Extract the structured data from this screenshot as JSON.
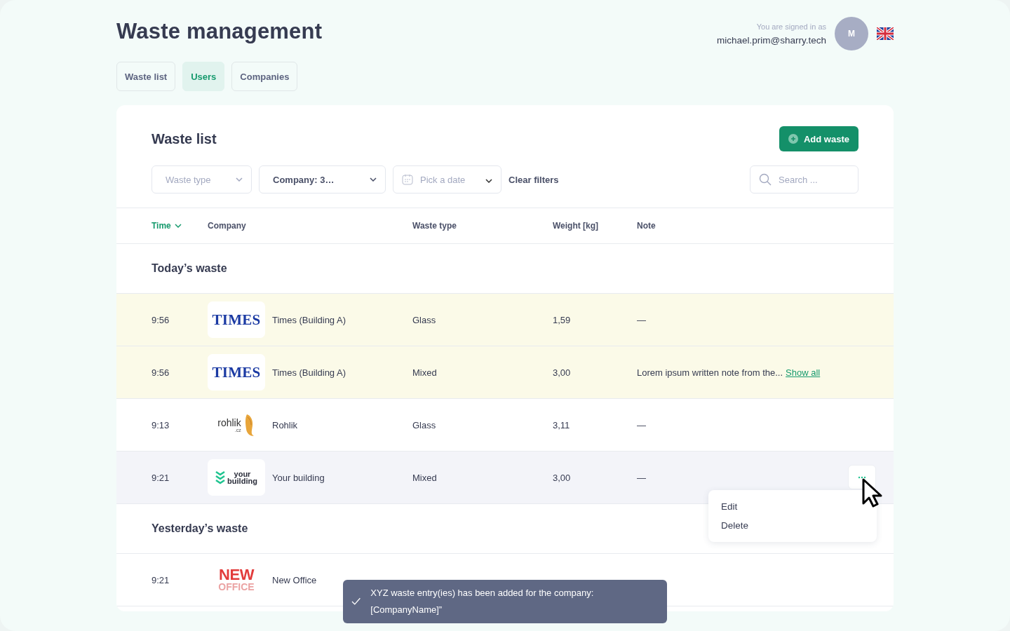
{
  "header": {
    "title": "Waste management",
    "signed_in_label": "You are signed in as",
    "email": "michael.prim@sharry.tech",
    "avatar_initial": "M"
  },
  "tabs": [
    {
      "label": "Waste list",
      "selected": false
    },
    {
      "label": "Users",
      "selected": true
    },
    {
      "label": "Companies",
      "selected": false
    }
  ],
  "panel": {
    "title": "Waste list",
    "add_button": "Add waste",
    "filters": [
      {
        "kind": "select",
        "placeholder": "Waste type"
      },
      {
        "kind": "select",
        "value": "Company: 3…"
      },
      {
        "kind": "date",
        "placeholder": "Pick a date"
      }
    ],
    "clear_filters": "Clear filters",
    "search": {
      "placeholder": "Search ..."
    }
  },
  "table": {
    "columns": [
      {
        "label": "Time",
        "sorted": true
      },
      {
        "label": "Company",
        "sorted": false
      },
      {
        "label": "Waste type",
        "sorted": false
      },
      {
        "label": "Weight [kg]",
        "sorted": false
      },
      {
        "label": "Note",
        "sorted": false
      }
    ],
    "groups": [
      {
        "title": "Today’s waste",
        "rows": [
          {
            "time": "9:56",
            "logo": {
              "kind": "times",
              "lines": [
                "TIMES"
              ]
            },
            "company": "Times (Building A)",
            "waste_type": "Glass",
            "weight": "1,59",
            "note": "—",
            "highlighted": true,
            "hovered": false
          },
          {
            "time": "9:56",
            "logo": {
              "kind": "times",
              "lines": [
                "TIMES"
              ]
            },
            "company": "Times (Building A)",
            "waste_type": "Mixed",
            "weight": "3,00",
            "note": "Lorem ipsum written note from the...",
            "note_link": "Show all",
            "highlighted": true,
            "hovered": false
          },
          {
            "time": "9:13",
            "logo": {
              "kind": "rohlik",
              "lines": [
                "rohlik",
                ".cz"
              ]
            },
            "company": "Rohlik",
            "waste_type": "Glass",
            "weight": "3,11",
            "note": "—",
            "highlighted": false,
            "hovered": false
          },
          {
            "time": "9:21",
            "logo": {
              "kind": "your_building",
              "lines": [
                "your",
                "building"
              ]
            },
            "company": "Your building",
            "waste_type": "Mixed",
            "weight": "3,00",
            "note": "—",
            "highlighted": false,
            "hovered": true,
            "menu": [
              "Edit",
              "Delete"
            ]
          }
        ]
      },
      {
        "title": "Yesterday’s waste",
        "rows": [
          {
            "time": "9:21",
            "logo": {
              "kind": "new_office",
              "lines": [
                "NEW",
                "OFFICE"
              ]
            },
            "company": "New Office",
            "highlighted": false,
            "hovered": false
          }
        ]
      }
    ]
  },
  "toast": {
    "message": "XYZ waste entry(ies) has been added for the company: [CompanyName]”"
  }
}
